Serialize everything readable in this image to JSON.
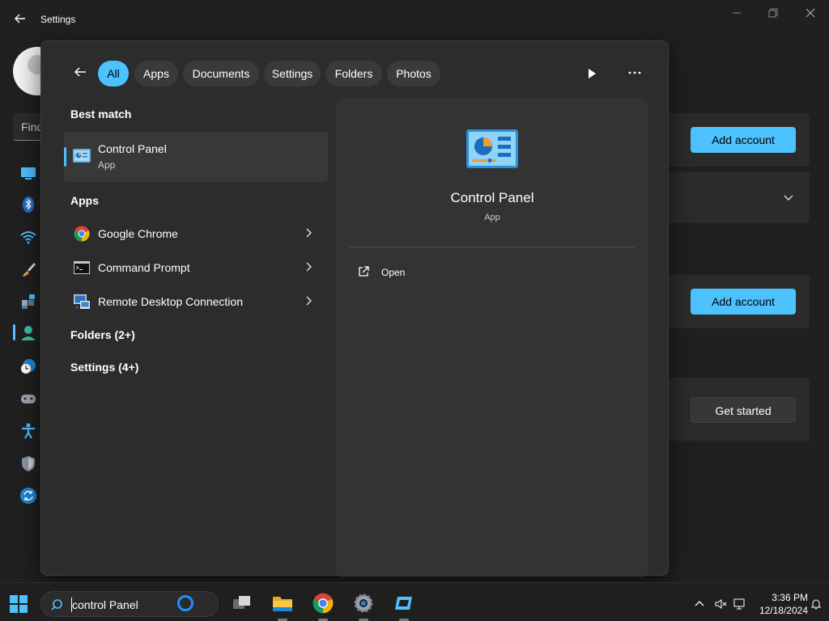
{
  "window": {
    "title": "Settings",
    "find_placeholder": "Find",
    "buttons": {
      "add_account_1": "Add account",
      "add_account_2": "Add account",
      "get_started": "Get started"
    }
  },
  "search": {
    "filters": [
      "All",
      "Apps",
      "Documents",
      "Settings",
      "Folders",
      "Photos"
    ],
    "active_filter": "All",
    "best_match_label": "Best match",
    "best_match": {
      "name": "Control Panel",
      "type": "App"
    },
    "apps_label": "Apps",
    "apps": [
      {
        "name": "Google Chrome",
        "icon": "chrome-icon"
      },
      {
        "name": "Command Prompt",
        "icon": "command-prompt-icon"
      },
      {
        "name": "Remote Desktop Connection",
        "icon": "remote-desktop-icon"
      }
    ],
    "folders_label": "Folders (2+)",
    "settings_label": "Settings (4+)",
    "preview": {
      "title": "Control Panel",
      "subtitle": "App",
      "open_label": "Open"
    }
  },
  "taskbar": {
    "search_query": "control Panel",
    "time": "3:36 PM",
    "date": "12/18/2024"
  },
  "colors": {
    "accent": "#4cc2ff",
    "panel": "#2c2c2c",
    "preview": "#333333"
  }
}
